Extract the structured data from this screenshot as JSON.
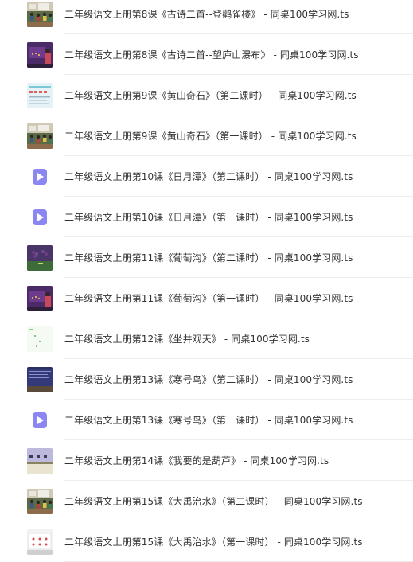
{
  "files": [
    {
      "name": "二年级语文上册第8课《古诗二首--登鹳雀楼》 - 同桌100学习网.ts",
      "thumb": "video-thumbnail-classroom"
    },
    {
      "name": "二年级语文上册第8课《古诗二首--望庐山瀑布》 - 同桌100学习网.ts",
      "thumb": "video-thumbnail-teacher"
    },
    {
      "name": "二年级语文上册第9课《黄山奇石》（第二课时） - 同桌100学习网.ts",
      "thumb": "video-thumbnail-slides"
    },
    {
      "name": "二年级语文上册第9课《黄山奇石》（第一课时） - 同桌100学习网.ts",
      "thumb": "video-thumbnail-classroom"
    },
    {
      "name": "二年级语文上册第10课《日月潭》（第二课时） - 同桌100学习网.ts",
      "thumb": "video-file-icon"
    },
    {
      "name": "二年级语文上册第10课《日月潭》（第一课时） - 同桌100学习网.ts",
      "thumb": "video-file-icon"
    },
    {
      "name": "二年级语文上册第11课《葡萄沟》（第二课时） - 同桌100学习网.ts",
      "thumb": "video-thumbnail-grapes"
    },
    {
      "name": "二年级语文上册第11课《葡萄沟》（第一课时） - 同桌100学习网.ts",
      "thumb": "video-thumbnail-teacher"
    },
    {
      "name": "二年级语文上册第12课《坐井观天》 - 同桌100学习网.ts",
      "thumb": "video-thumbnail-light"
    },
    {
      "name": "二年级语文上册第13课《寒号鸟》（第二课时） - 同桌100学习网.ts",
      "thumb": "video-thumbnail-dark"
    },
    {
      "name": "二年级语文上册第13课《寒号鸟》（第一课时） - 同桌100学习网.ts",
      "thumb": "video-file-icon"
    },
    {
      "name": "二年级语文上册第14课《我要的是葫芦》 - 同桌100学习网.ts",
      "thumb": "video-thumbnail-sky"
    },
    {
      "name": "二年级语文上册第15课《大禹治水》（第二课时） - 同桌100学习网.ts",
      "thumb": "video-thumbnail-classroom"
    },
    {
      "name": "二年级语文上册第15课《大禹治水》（第一课时） - 同桌100学习网.ts",
      "thumb": "video-thumbnail-cards"
    }
  ],
  "colors": {
    "text": "#333333",
    "divider": "#ededed",
    "video_icon": "#8b86f2"
  }
}
